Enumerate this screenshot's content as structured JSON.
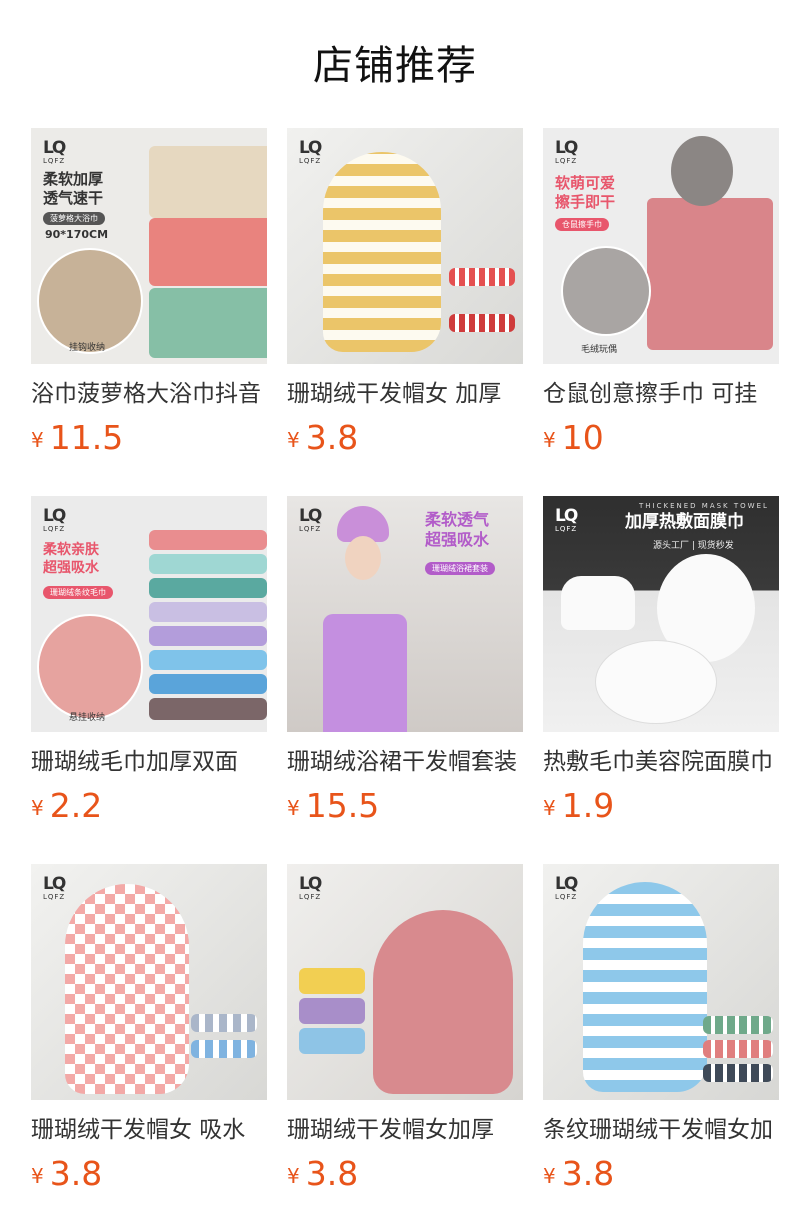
{
  "header": {
    "title": "店铺推荐"
  },
  "brand": {
    "logo_mark": "LQ",
    "logo_text": "LQFZ"
  },
  "products": [
    {
      "name": "浴巾菠萝格大浴巾抖音",
      "currency": "¥",
      "price": "11.5",
      "overlay": {
        "line1": "柔软加厚",
        "line2": "透气速干",
        "tag": "菠萝格大浴巾",
        "size": "90*170CM",
        "caption": "挂钩收纳"
      }
    },
    {
      "name": "珊瑚绒干发帽女 加厚",
      "currency": "¥",
      "price": "3.8"
    },
    {
      "name": "仓鼠创意擦手巾 可挂",
      "currency": "¥",
      "price": "10",
      "overlay": {
        "line1": "软萌可爱",
        "line2": "擦手即干",
        "tag": "仓鼠擦手巾",
        "caption": "毛绒玩偶"
      }
    },
    {
      "name": "珊瑚绒毛巾加厚双面",
      "currency": "¥",
      "price": "2.2",
      "overlay": {
        "line1": "柔软亲肤",
        "line2": "超强吸水",
        "tag": "珊瑚绒条纹毛巾",
        "caption": "悬挂收纳"
      }
    },
    {
      "name": "珊瑚绒浴裙干发帽套装",
      "currency": "¥",
      "price": "15.5",
      "overlay": {
        "line1": "柔软透气",
        "line2": "超强吸水",
        "tag": "珊瑚绒浴裙套装"
      }
    },
    {
      "name": "热敷毛巾美容院面膜巾",
      "currency": "¥",
      "price": "1.9",
      "overlay": {
        "small": "THICKENED MASK TOWEL",
        "line1": "加厚热敷面膜巾",
        "sub1": "源头工厂",
        "sub2": "现货秒发"
      }
    },
    {
      "name": "珊瑚绒干发帽女 吸水",
      "currency": "¥",
      "price": "3.8"
    },
    {
      "name": "珊瑚绒干发帽女加厚",
      "currency": "¥",
      "price": "3.8"
    },
    {
      "name": "条纹珊瑚绒干发帽女加",
      "currency": "¥",
      "price": "3.8"
    }
  ],
  "colors": {
    "price": "#e8541a",
    "accent_pink": "#e8566c",
    "accent_purple": "#b25cc9"
  }
}
